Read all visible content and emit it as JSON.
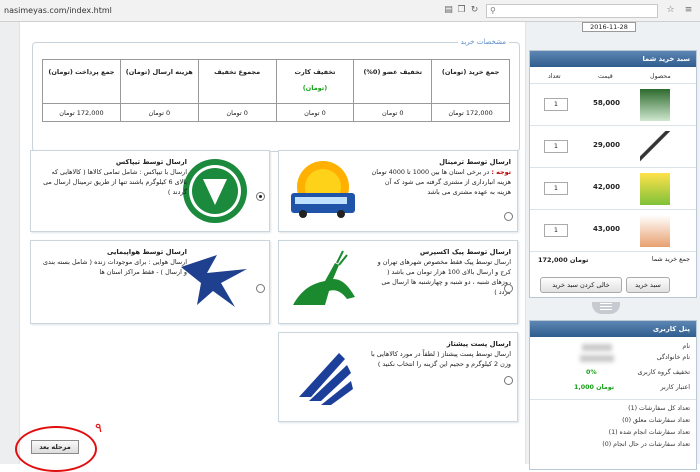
{
  "browser": {
    "url": "nasimeyas.com/index.html"
  },
  "date": "2016-11-28",
  "specs": {
    "title": "مشخصات خرید",
    "headers": [
      "جمع خرید (تومان)",
      "تخفیف عضو (0%)",
      "تخفیف کارت",
      "مجموع تخفیف",
      "هزینه ارسال (تومان)",
      "جمع پرداخت (تومان)"
    ],
    "card_sub": "(تومان)",
    "values": [
      "172,000 تومان",
      "0 تومان",
      "0 تومان",
      "0 تومان",
      "0 تومان",
      "172,000 تومان"
    ]
  },
  "shipping": {
    "terminal": {
      "title": "ارسال توسط ترمینال",
      "note": "توجه :",
      "text": "در برخی استان ها بین 1000 تا 4000 تومان هزینه انبارداری از مشتری گرفته می شود که آن هزینه به عهده مشتری می باشد"
    },
    "tipax": {
      "title": "ارسال توسط تیپاکس",
      "text": "ارسال با تیپاکس : شامل تمامی کالاها ( کالاهایی که بالای 6 کیلوگرم باشند تنها از طریق ترمینال ارسال می گردند )"
    },
    "express": {
      "title": "ارسال توسط پیک اکسپرس",
      "text": "ارسال توسط پیک فقط مخصوص شهرهای تهران و کرج و ارسال بالای 100 هزار تومان می باشد ( روزهای شنبه ، دو شنبه و چهارشنبه ها ارسال می گردد )"
    },
    "air": {
      "title": "ارسال توسط هواپیمایی",
      "text": "ارسال هوایی : برای موجودات زنده ( شامل بسته بندی و ارسال ) - فقط مراکز استان ها"
    },
    "post": {
      "title": "ارسال پست پیشتاز",
      "text": "ارسال توسط پست پیشتاز ( لطفاً در مورد کالاهایی با وزن 2 کیلوگرم و حجیم این گزینه را انتخاب نکنید )"
    }
  },
  "next_button": "مرحله بعد",
  "annotation": "۹",
  "cart": {
    "title": "سبد خرید شما",
    "col_product": "محصول",
    "col_price": "قیمت",
    "col_qty": "تعداد",
    "items": [
      {
        "qty": "1",
        "price": "58,000"
      },
      {
        "qty": "1",
        "price": "29,000"
      },
      {
        "qty": "1",
        "price": "42,000"
      },
      {
        "qty": "1",
        "price": "43,000"
      }
    ],
    "total_label": "جمع خرید شما",
    "total_value": "172,000 تومان",
    "btn_cart": "سبد خرید",
    "btn_clear": "خالی کردن سبد خرید"
  },
  "user": {
    "title": "پنل کاربری",
    "name_label": "نام",
    "family_label": "نام خانوادگی",
    "group_discount_label": "تخفیف گروه کاربری",
    "group_discount": "0%",
    "credit_label": "اعتبار کاربر",
    "credit": "1,000 تومان",
    "orders_total": "تعداد کل سفارشات (1)",
    "orders_pending": "تعداد سفارشات معلق (0)",
    "orders_done": "تعداد سفارشات انجام شده (1)",
    "orders_inprogress": "تعداد سفارشات در حال انجام (0)"
  },
  "colors": {
    "header_blue": "#2f5d8e",
    "green": "#17a117",
    "annotation_red": "#e01010"
  }
}
